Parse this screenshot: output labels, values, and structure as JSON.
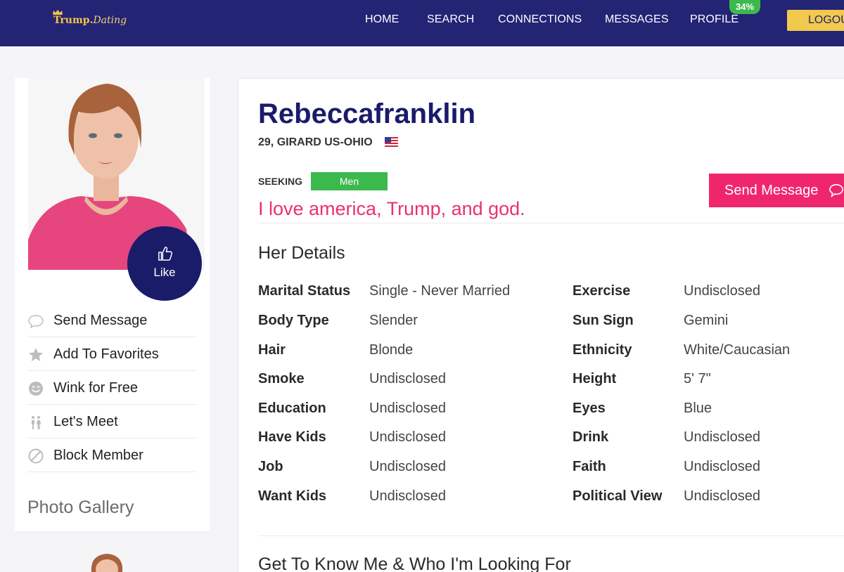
{
  "header": {
    "logo_main": "Trump",
    "logo_accent": "Dating",
    "nav": [
      "HOME",
      "SEARCH",
      "CONNECTIONS",
      "MESSAGES",
      "PROFILE"
    ],
    "profile_badge": "34%",
    "logout_label": "LOGOUT"
  },
  "sidebar": {
    "like_label": "Like",
    "actions": [
      {
        "label": "Send Message",
        "icon": "speech-bubble-icon"
      },
      {
        "label": "Add To Favorites",
        "icon": "star-icon"
      },
      {
        "label": "Wink for Free",
        "icon": "smiley-icon"
      },
      {
        "label": "Let's Meet",
        "icon": "couple-icon"
      },
      {
        "label": "Block Member",
        "icon": "block-icon"
      }
    ],
    "gallery_title": "Photo Gallery"
  },
  "profile": {
    "name": "Rebeccafranklin",
    "location": "29, GIRARD US-OHIO",
    "seeking_label": "SEEKING",
    "seeking_value": "Men",
    "send_message_label": "Send Message",
    "tagline": "I love america, Trump, and god.",
    "details_title": "Her Details",
    "details_left": [
      {
        "key": "Marital Status",
        "value": "Single - Never Married"
      },
      {
        "key": "Body Type",
        "value": "Slender"
      },
      {
        "key": "Hair",
        "value": "Blonde"
      },
      {
        "key": "Smoke",
        "value": "Undisclosed"
      },
      {
        "key": "Education",
        "value": "Undisclosed"
      },
      {
        "key": "Have Kids",
        "value": "Undisclosed"
      },
      {
        "key": "Job",
        "value": "Undisclosed"
      },
      {
        "key": "Want Kids",
        "value": "Undisclosed"
      }
    ],
    "details_right": [
      {
        "key": "Exercise",
        "value": "Undisclosed"
      },
      {
        "key": "Sun Sign",
        "value": "Gemini"
      },
      {
        "key": "Ethnicity",
        "value": "White/Caucasian"
      },
      {
        "key": "Height",
        "value": "5' 7\""
      },
      {
        "key": "Eyes",
        "value": "Blue"
      },
      {
        "key": "Drink",
        "value": "Undisclosed"
      },
      {
        "key": "Faith",
        "value": "Undisclosed"
      },
      {
        "key": "Political View",
        "value": "Undisclosed"
      }
    ],
    "about_title": "Get To Know Me & Who I'm Looking For"
  },
  "colors": {
    "header_bg": "#232474",
    "accent_pink": "#f0266c",
    "seeking_green": "#3cb94d",
    "logout_yellow": "#f2c94c",
    "name_navy": "#1a1b6b"
  }
}
